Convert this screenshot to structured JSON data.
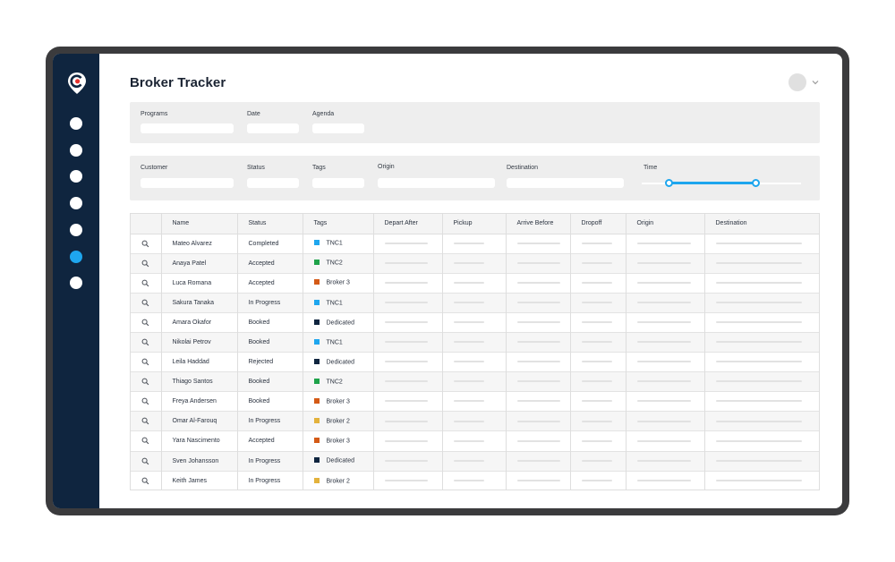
{
  "app": {
    "title": "Broker Tracker"
  },
  "sidebar": {
    "items": [
      {
        "id": "nav-1",
        "active": false
      },
      {
        "id": "nav-2",
        "active": false
      },
      {
        "id": "nav-3",
        "active": false
      },
      {
        "id": "nav-4",
        "active": false
      },
      {
        "id": "nav-5",
        "active": false
      },
      {
        "id": "nav-6",
        "active": true
      },
      {
        "id": "nav-7",
        "active": false
      }
    ]
  },
  "filters_top": {
    "programs_label": "Programs",
    "date_label": "Date",
    "agenda_label": "Agenda"
  },
  "filters_bottom": {
    "customer_label": "Customer",
    "status_label": "Status",
    "tags_label": "Tags",
    "origin_label": "Origin",
    "destination_label": "Destination",
    "time_label": "Time"
  },
  "table": {
    "columns": [
      "",
      "Name",
      "Status",
      "Tags",
      "Depart After",
      "Pickup",
      "Arrive Before",
      "Dropoff",
      "Origin",
      "Destination"
    ],
    "rows": [
      {
        "name": "Mateo Alvarez",
        "status": "Completed",
        "tag": "TNC1",
        "tag_color": "#1ea6ee"
      },
      {
        "name": "Anaya Patel",
        "status": "Accepted",
        "tag": "TNC2",
        "tag_color": "#1fa34a"
      },
      {
        "name": "Luca Romana",
        "status": "Accepted",
        "tag": "Broker 3",
        "tag_color": "#d45a16"
      },
      {
        "name": "Sakura Tanaka",
        "status": "In Progress",
        "tag": "TNC1",
        "tag_color": "#1ea6ee"
      },
      {
        "name": "Amara Okafor",
        "status": "Booked",
        "tag": "Dedicated",
        "tag_color": "#0f253f"
      },
      {
        "name": "Nikolai Petrov",
        "status": "Booked",
        "tag": "TNC1",
        "tag_color": "#1ea6ee"
      },
      {
        "name": "Leila Haddad",
        "status": "Rejected",
        "tag": "Dedicated",
        "tag_color": "#0f253f"
      },
      {
        "name": "Thiago Santos",
        "status": "Booked",
        "tag": "TNC2",
        "tag_color": "#1fa34a"
      },
      {
        "name": "Freya Andersen",
        "status": "Booked",
        "tag": "Broker 3",
        "tag_color": "#d45a16"
      },
      {
        "name": "Omar Al-Farouq",
        "status": "In Progress",
        "tag": "Broker 2",
        "tag_color": "#e3b23c"
      },
      {
        "name": "Yara Nascimento",
        "status": "Accepted",
        "tag": "Broker 3",
        "tag_color": "#d45a16"
      },
      {
        "name": "Sven Johansson",
        "status": "In Progress",
        "tag": "Dedicated",
        "tag_color": "#0f253f"
      },
      {
        "name": "Keith James",
        "status": "In Progress",
        "tag": "Broker 2",
        "tag_color": "#e3b23c"
      }
    ]
  },
  "colors": {
    "sidebar": "#0f253f",
    "accent": "#1ea6ee",
    "logo_red": "#e5322d"
  },
  "icons": {
    "logo": "location-pin-logo",
    "row_action": "search-icon",
    "avatar_menu": "chevron-down-icon"
  }
}
